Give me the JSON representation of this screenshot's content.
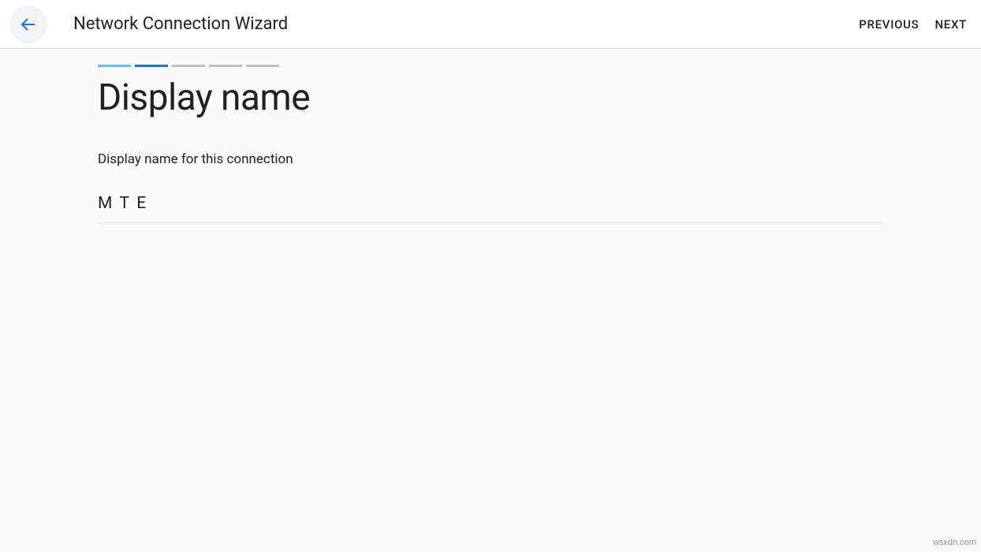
{
  "header": {
    "title": "Network Connection Wizard",
    "previous_label": "PREVIOUS",
    "next_label": "NEXT"
  },
  "progress": {
    "total_steps": 5,
    "current_step": 2
  },
  "page": {
    "heading": "Display name",
    "field_label": "Display name for this connection",
    "input_value": "M T E"
  },
  "watermark": "wsxdn.com"
}
